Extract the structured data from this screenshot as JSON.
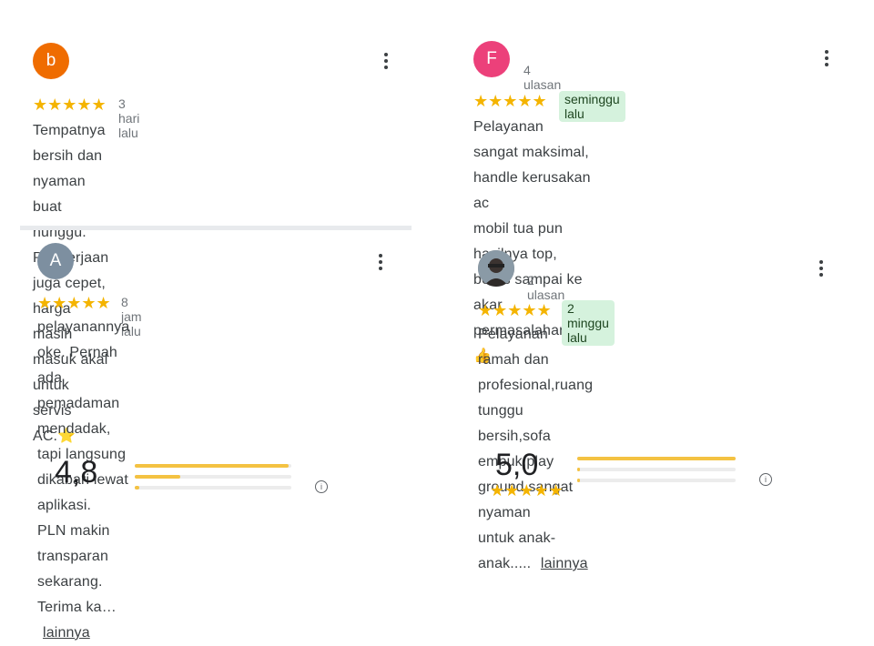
{
  "reviews": [
    {
      "avatar_letter": "b",
      "avatar_color": "#ef6c00",
      "count": "",
      "stars": "★★★★★",
      "time": "3 hari lalu",
      "lines": [
        "Tempatnya bersih dan nyaman buat nunggu.",
        "Pengerjaan juga cepet, harga masih masuk akal",
        "untuk servis AC.⭐"
      ]
    },
    {
      "avatar_letter": "A",
      "avatar_color": "#7d8fa0",
      "count": "",
      "stars": "★★★★★",
      "time": "8 jam lalu",
      "lines": [
        "pelayanannya oke. Pernah ada pemadaman",
        "mendadak, tapi langsung dikabari lewat aplikasi.",
        "PLN makin transparan sekarang. Terima ka…"
      ],
      "more_link": "lainnya"
    },
    {
      "avatar_letter": "F",
      "avatar_color": "#ec407a",
      "count": "4 ulasan",
      "stars": "★★★★★",
      "time": "seminggu lalu",
      "lines": [
        "Pelayanan sangat maksimal, handle kerusakan ac",
        "mobil tua pun hasilnya top, beres sampai ke akar",
        "permasalahannya 👍"
      ]
    },
    {
      "avatar_letter": "",
      "avatar_color": "#6d6d6d",
      "count": "2 ulasan",
      "stars": "★★★★★",
      "time": "2 minggu lalu",
      "lines": [
        "Pelayanan ramah dan profesional,ruang tunggu",
        "bersih,sofa empuk,play ground sangat nyaman",
        "untuk anak-anak....."
      ],
      "more_link": "lainnya"
    }
  ],
  "summaries": [
    {
      "rating": "4,8",
      "bars": [
        0.98,
        0.29,
        0.03
      ]
    },
    {
      "rating": "5,0",
      "bars": [
        1.0,
        0.02,
        0.02
      ]
    }
  ],
  "info_icon_glyph": "i"
}
